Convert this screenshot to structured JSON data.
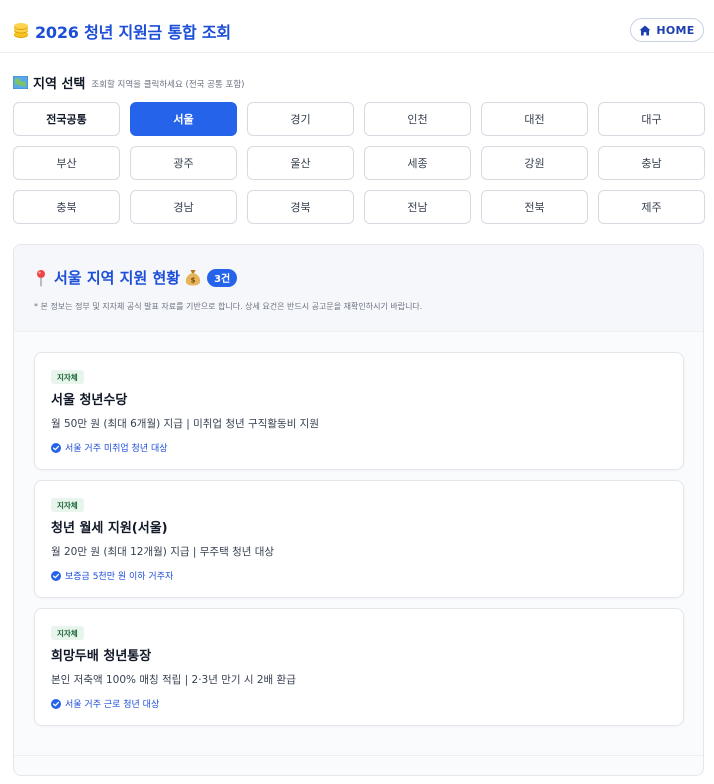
{
  "header": {
    "title": "2026 청년 지원금 통합 조회",
    "home_label": "HOME",
    "icon": "coin-stack-icon"
  },
  "region": {
    "title": "지역 선택",
    "hint": "조회할 지역을 클릭하세요 (전국 공통 포함)",
    "selected": "서울",
    "buttons": [
      "전국공통",
      "서울",
      "경기",
      "인천",
      "대전",
      "대구",
      "부산",
      "광주",
      "울산",
      "세종",
      "강원",
      "충남",
      "충북",
      "경남",
      "경북",
      "전남",
      "전북",
      "제주"
    ]
  },
  "panel": {
    "title": "서울 지역 지원 현황",
    "count": "3건",
    "note": "* 본 정보는 정부 및 지자체 공식 발표 자료를 기반으로 합니다. 상세 요건은 반드시 공고문을 재확인하시기 바랍니다."
  },
  "programs": [
    {
      "tag": "지자체",
      "title": "서울 청년수당",
      "desc": "월 50만 원 (최대 6개월) 지급 | 미취업 청년 구직활동비 지원",
      "condition": "서울 거주 미취업 청년 대상"
    },
    {
      "tag": "지자체",
      "title": "청년 월세 지원(서울)",
      "desc": "월 20만 원 (최대 12개월) 지급 | 무주택 청년 대상",
      "condition": "보증금 5천만 원 이하 거주자"
    },
    {
      "tag": "지자체",
      "title": "희망두배 청년통장",
      "desc": "본인 저축액 100% 매칭 적립 | 2·3년 만기 시 2배 환급",
      "condition": "서울 거주 근로 청년 대상"
    }
  ],
  "colors": {
    "accent": "#2563eb",
    "title": "#1d4ed8",
    "tag_bg": "#e7f5ec",
    "tag_text": "#166534"
  }
}
